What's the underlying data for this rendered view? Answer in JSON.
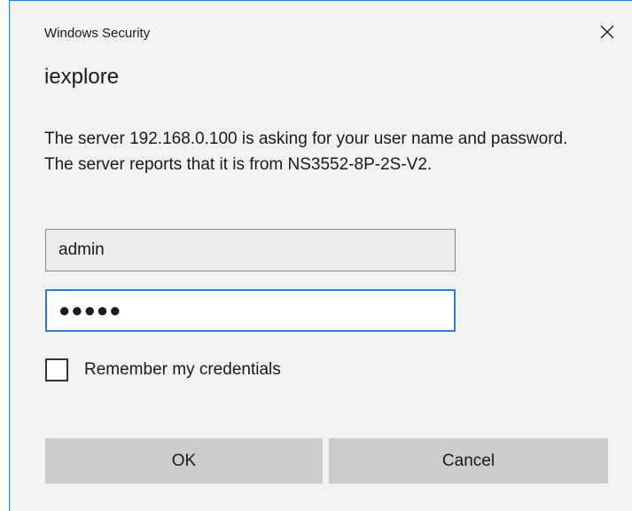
{
  "window": {
    "title": "Windows Security",
    "close_icon": "close-icon"
  },
  "dialog": {
    "app_name": "iexplore",
    "message": "The server 192.168.0.100 is asking for your user name and password. The server reports that it is from NS3552-8P-2S-V2.",
    "username_value": "admin",
    "password_value": "●●●●●",
    "remember_label": "Remember my credentials",
    "remember_checked": false
  },
  "buttons": {
    "ok_label": "OK",
    "cancel_label": "Cancel"
  },
  "colors": {
    "accent": "#2b79d8",
    "dialog_background": "#f2f2f2",
    "button_background": "#cccccc"
  }
}
